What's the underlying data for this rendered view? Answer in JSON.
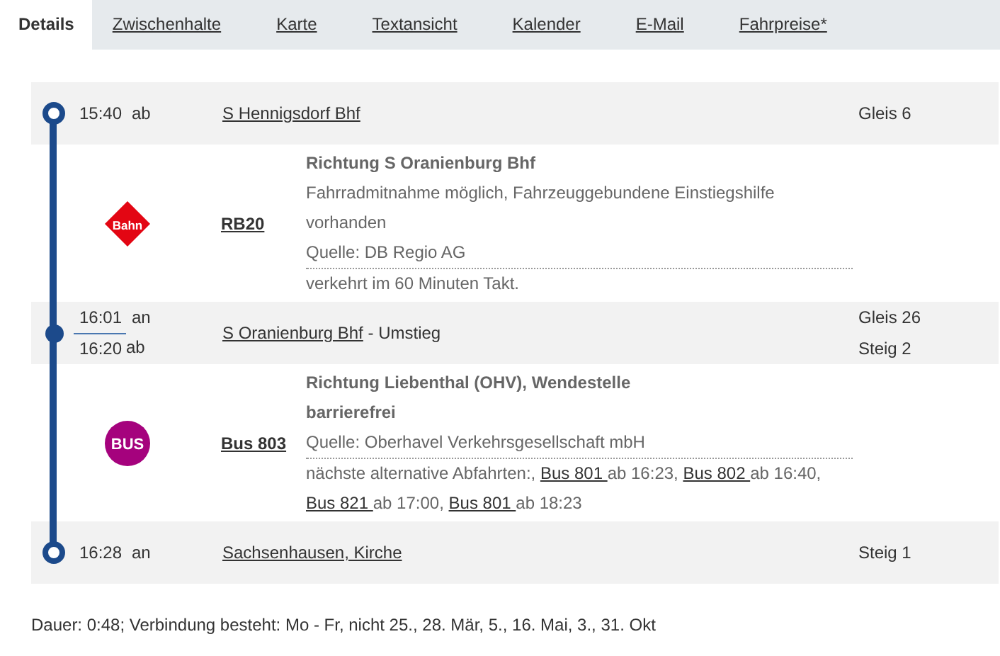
{
  "tabs": [
    {
      "label": "Details",
      "selected": true
    },
    {
      "label": "Zwischenhalte",
      "selected": false
    },
    {
      "label": "Karte",
      "selected": false
    },
    {
      "label": "Textansicht",
      "selected": false
    },
    {
      "label": "Kalender",
      "selected": false
    },
    {
      "label": "E-Mail",
      "selected": false
    },
    {
      "label": "Fahrpreise*",
      "selected": false
    }
  ],
  "journey": [
    {
      "kind": "stop",
      "transfer": false,
      "times": [
        {
          "time": "15:40",
          "type": "ab"
        }
      ],
      "station": "S Hennigsdorf Bhf",
      "platforms": [
        "Gleis 6"
      ]
    },
    {
      "kind": "leg",
      "logo": {
        "kind": "rail",
        "label": "Bahn"
      },
      "line": "RB20",
      "notes": [
        {
          "kind": "heading",
          "text": "Richtung S Oranienburg Bhf"
        },
        {
          "kind": "note",
          "text": "Fahrradmitnahme möglich, Fahrzeuggebundene Einstiegshilfe vorhanden"
        },
        {
          "kind": "source",
          "text": "Quelle: DB Regio AG"
        },
        {
          "kind": "note",
          "text": "verkehrt im 60 Minuten Takt."
        }
      ]
    },
    {
      "kind": "stop",
      "transfer": true,
      "times": [
        {
          "time": "16:01",
          "type": "an"
        },
        {
          "time": "16:20",
          "type": "ab"
        }
      ],
      "station": "S Oranienburg Bhf",
      "suffix": " - Umstieg",
      "platforms": [
        "Gleis 26",
        "Steig 2"
      ]
    },
    {
      "kind": "leg",
      "logo": {
        "kind": "bus",
        "label": "BUS"
      },
      "line": "Bus 803",
      "notes": [
        {
          "kind": "heading",
          "text": "Richtung Liebenthal (OHV), Wendestelle"
        },
        {
          "kind": "heading",
          "text": "barrierefrei"
        },
        {
          "kind": "source",
          "text": "Quelle: Oberhavel Verkehrsgesellschaft mbH"
        },
        {
          "kind": "alternatives",
          "parts": [
            {
              "kind": "text",
              "text": "nächste alternative Abfahrten:, "
            },
            {
              "kind": "link",
              "text": "Bus 801 "
            },
            {
              "kind": "text",
              "text": "ab 16:23, "
            },
            {
              "kind": "link",
              "text": "Bus 802 "
            },
            {
              "kind": "text",
              "text": "ab 16:40, "
            },
            {
              "kind": "link",
              "text": "Bus 821 "
            },
            {
              "kind": "text",
              "text": "ab 17:00, "
            },
            {
              "kind": "link",
              "text": "Bus 801 "
            },
            {
              "kind": "text",
              "text": "ab 18:23"
            }
          ]
        }
      ]
    },
    {
      "kind": "stop",
      "transfer": false,
      "times": [
        {
          "time": "16:28",
          "type": "an"
        }
      ],
      "station": "Sachsenhausen, Kirche",
      "platforms": [
        "Steig 1"
      ]
    }
  ],
  "footer": "Dauer: 0:48; Verbindung besteht: Mo - Fr, nicht 25., 28. Mär, 5., 16. Mai, 3., 31. Okt"
}
